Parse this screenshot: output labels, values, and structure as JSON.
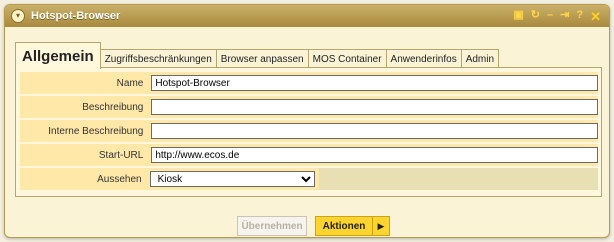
{
  "window": {
    "title": "Hotspot-Browser",
    "icons": [
      "window-icon",
      "refresh-icon",
      "minimize-icon",
      "pin-icon",
      "help-icon",
      "close-icon"
    ]
  },
  "tabs": [
    {
      "label": "Allgemein",
      "active": true
    },
    {
      "label": "Zugriffsbeschränkungen",
      "active": false
    },
    {
      "label": "Browser anpassen",
      "active": false
    },
    {
      "label": "MOS Container",
      "active": false
    },
    {
      "label": "Anwenderinfos",
      "active": false
    },
    {
      "label": "Admin",
      "active": false
    }
  ],
  "form": {
    "name": {
      "label": "Name",
      "value": "Hotspot-Browser"
    },
    "beschreibung": {
      "label": "Beschreibung",
      "value": ""
    },
    "interne_beschreibung": {
      "label": "Interne Beschreibung",
      "value": ""
    },
    "start_url": {
      "label": "Start-URL",
      "value": "http://www.ecos.de"
    },
    "aussehen": {
      "label": "Aussehen",
      "selected": "Kiosk"
    }
  },
  "buttons": {
    "apply": "Übernehmen",
    "actions": "Aktionen"
  },
  "colors": {
    "titlebar": "#b59843",
    "row_bg": "#ffe8a8",
    "accent_button": "#ffd42e"
  }
}
